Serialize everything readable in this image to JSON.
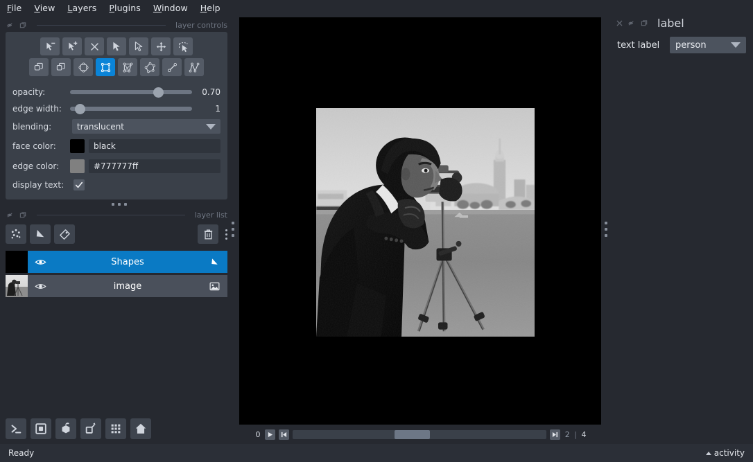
{
  "menu": {
    "items": [
      {
        "label": "File",
        "accel": "F"
      },
      {
        "label": "View",
        "accel": "V"
      },
      {
        "label": "Layers",
        "accel": "L"
      },
      {
        "label": "Plugins",
        "accel": "P"
      },
      {
        "label": "Window",
        "accel": "W"
      },
      {
        "label": "Help",
        "accel": "H"
      }
    ]
  },
  "layer_controls": {
    "dock_title": "layer controls",
    "tools_row1": [
      {
        "name": "select-vertex-remove",
        "title": "remove point"
      },
      {
        "name": "select-vertex-add",
        "title": "add point"
      },
      {
        "name": "delete-shape",
        "title": "delete"
      },
      {
        "name": "pan-select-arrow",
        "title": "select"
      },
      {
        "name": "direct-select-arrow",
        "title": "direct select"
      },
      {
        "name": "move-cross-arrows",
        "title": "move"
      },
      {
        "name": "transform-shape",
        "title": "transform"
      }
    ],
    "tools_row2": [
      {
        "name": "duplicate-shape",
        "title": "duplicate"
      },
      {
        "name": "copy-shape",
        "title": "copy"
      },
      {
        "name": "add-ellipse",
        "title": "ellipse"
      },
      {
        "name": "add-rectangle",
        "title": "rectangle",
        "selected": true
      },
      {
        "name": "add-polygon-box",
        "title": "polygon box"
      },
      {
        "name": "add-polygon",
        "title": "polygon"
      },
      {
        "name": "add-line",
        "title": "line"
      },
      {
        "name": "add-path",
        "title": "path"
      }
    ],
    "fields": {
      "opacity_label": "opacity:",
      "opacity_value": "0.70",
      "opacity_pct": 70,
      "edge_width_label": "edge width:",
      "edge_width_value": "1",
      "edge_width_pct": 4,
      "blending_label": "blending:",
      "blending_value": "translucent",
      "face_color_label": "face color:",
      "face_color_value": "black",
      "face_color_hex": "#000000",
      "edge_color_label": "edge color:",
      "edge_color_value": "#777777ff",
      "edge_color_hex": "#808080",
      "display_text_label": "display text:",
      "display_text_checked": true
    }
  },
  "layer_list": {
    "dock_title": "layer list",
    "buttons": [
      {
        "name": "new-points-layer",
        "title": "new points layer"
      },
      {
        "name": "new-shapes-layer",
        "title": "new shapes layer"
      },
      {
        "name": "new-labels-layer",
        "title": "new labels layer"
      },
      {
        "name": "delete-layer",
        "title": "delete layer"
      }
    ],
    "rows": [
      {
        "name": "Shapes",
        "type": "shapes",
        "visible": true,
        "selected": true
      },
      {
        "name": "image",
        "type": "image",
        "visible": true,
        "selected": false
      }
    ]
  },
  "bottom_tools": [
    {
      "name": "console-button",
      "title": "console"
    },
    {
      "name": "toggle-2d-3d-button",
      "title": "2D / 3D"
    },
    {
      "name": "roll-dimensions-button",
      "title": "roll dimensions"
    },
    {
      "name": "transpose-dimensions-button",
      "title": "transpose dimensions"
    },
    {
      "name": "grid-view-button",
      "title": "grid"
    },
    {
      "name": "home-reset-button",
      "title": "reset view"
    }
  ],
  "playbar": {
    "current_frame": "0",
    "play_title": "play",
    "first_frame_title": "first frame",
    "last_frame_title": "last frame",
    "slider_pct_start": 40,
    "slider_pct_width": 14,
    "axis_index": "2",
    "axis_separator": "|",
    "axis_total": "4"
  },
  "right_dock": {
    "dock_title": "label",
    "text_label_caption": "text label",
    "text_label_value": "person"
  },
  "statusbar": {
    "status": "Ready",
    "activity": "activity"
  },
  "canvas": {
    "image_alt": "cameraman-photograph",
    "background": "#000000"
  }
}
